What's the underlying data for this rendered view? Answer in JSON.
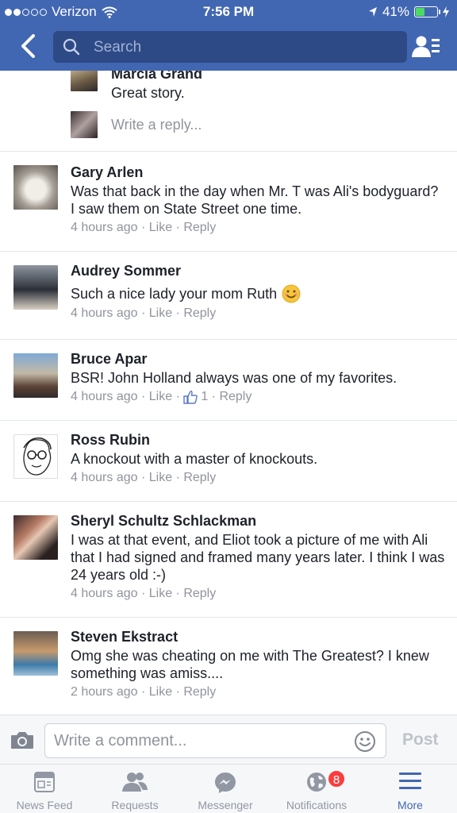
{
  "status_bar": {
    "carrier": "Verizon",
    "time": "7:56 PM",
    "battery": "41%",
    "battery_level": 0.41
  },
  "search": {
    "placeholder": "Search"
  },
  "reply_thread": {
    "author": "Marcia Grand",
    "text": "Great story.",
    "reply_placeholder": "Write a reply..."
  },
  "comments": [
    {
      "author": "Gary Arlen",
      "text": "Was that back in the day when Mr. T was Ali's bodyguard?  I saw them on State Street one time.",
      "time": "4 hours ago",
      "like": "Like",
      "reply": "Reply"
    },
    {
      "author": "Audrey Sommer",
      "text": "Such a nice lady your mom Ruth",
      "time": "4 hours ago",
      "like": "Like",
      "reply": "Reply"
    },
    {
      "author": "Bruce Apar",
      "text": "BSR! John Holland always was one of my favorites.",
      "time": "4 hours ago",
      "like": "Like",
      "likes_count": "1",
      "reply": "Reply"
    },
    {
      "author": "Ross Rubin",
      "text": "A knockout with a master of knockouts.",
      "time": "4 hours ago",
      "like": "Like",
      "reply": "Reply"
    },
    {
      "author": "Sheryl Schultz Schlackman",
      "text": "I was at that event, and Eliot took a picture of me with Ali that I had signed and framed many years later.  I think I was 24 years old :-)",
      "time": "4 hours ago",
      "like": "Like",
      "reply": "Reply"
    },
    {
      "author": "Steven Ekstract",
      "text": "Omg she was cheating on me with The Greatest? I knew something was amiss....",
      "time": "2 hours ago",
      "like": "Like",
      "reply": "Reply"
    }
  ],
  "composer": {
    "placeholder": "Write a comment...",
    "post_label": "Post"
  },
  "tabs": [
    {
      "label": "News Feed",
      "icon": "news-feed-icon"
    },
    {
      "label": "Requests",
      "icon": "friends-icon"
    },
    {
      "label": "Messenger",
      "icon": "messenger-icon"
    },
    {
      "label": "Notifications",
      "icon": "globe-icon",
      "badge": "8"
    },
    {
      "label": "More",
      "icon": "menu-icon"
    }
  ],
  "colors": {
    "brand": "#4267b2",
    "muted": "#90949c",
    "badge": "#fa3e3e",
    "battery": "#4cd964"
  }
}
